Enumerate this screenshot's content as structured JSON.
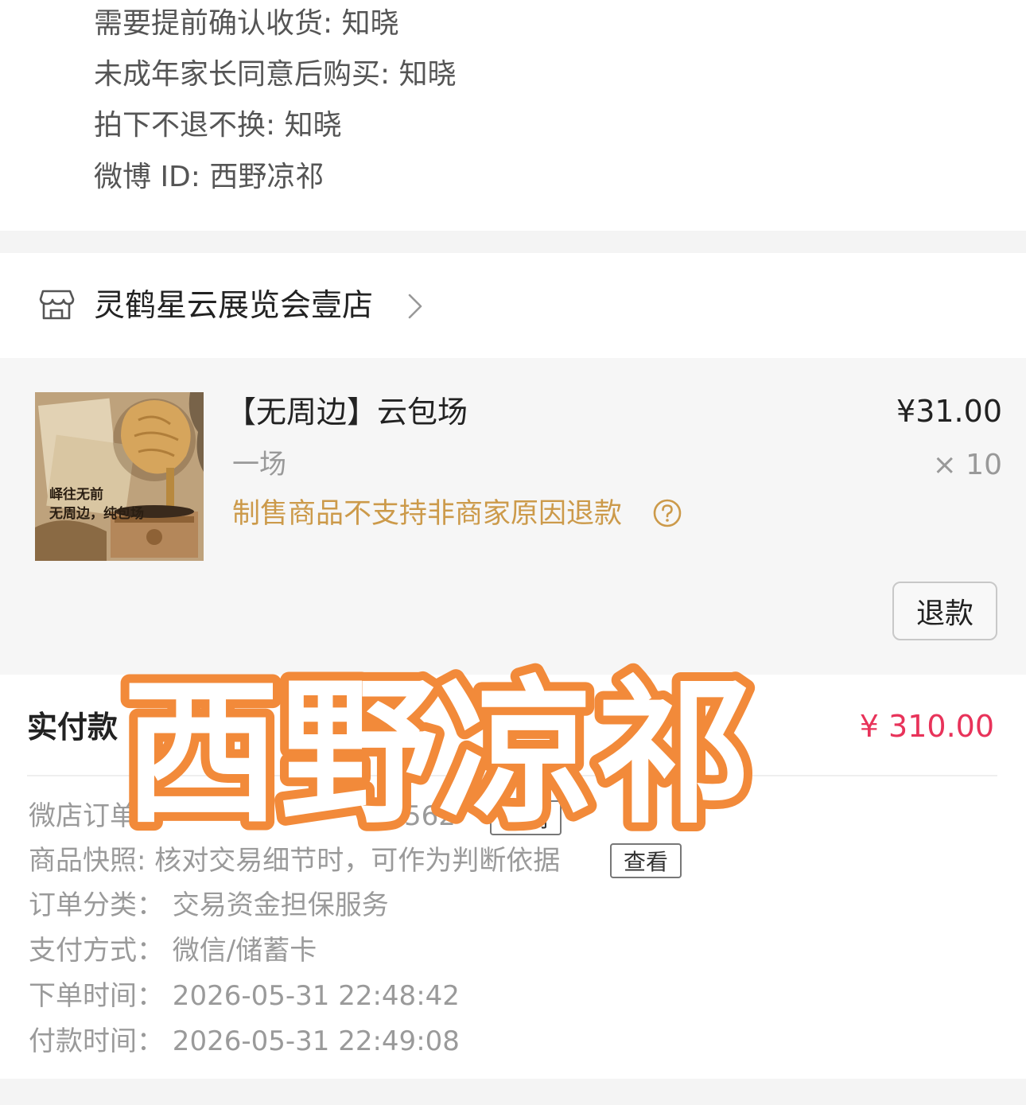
{
  "info_lines": [
    "需要提前确认收货: 知晓",
    "未成年家长同意后购买: 知晓",
    "拍下不退不换: 知晓",
    "微博 ID: 西野凉祁"
  ],
  "shop": {
    "name": "灵鹤星云展览会壹店",
    "icon": "shop-icon"
  },
  "product": {
    "title": "【无周边】云包场",
    "spec": "一场",
    "notice": "制售商品不支持非商家原因退款",
    "price": "¥31.00",
    "quantity": "× 10",
    "refund_label": "退款",
    "thumb_lines": [
      "峄往无前",
      "无周边，纯包场"
    ]
  },
  "payment": {
    "paid_label": "实付款",
    "paid_amount": "¥ 310.00",
    "order_no_label": "微店订单",
    "order_no_fragment": "562",
    "copy_label": "复制",
    "snapshot_line": "商品快照: 核对交易细节时，可作为判断依据",
    "view_label": "查看",
    "order_type": "订单分类：  交易资金担保服务",
    "pay_method": "支付方式：  微信/储蓄卡",
    "order_time": "下单时间：  2026-05-31 22:48:42",
    "pay_time": "付款时间：  2026-05-31 22:49:08"
  },
  "watermark": {
    "text": "西野凉祁",
    "color": "#f28a3a"
  },
  "colors": {
    "price_red": "#e8335a",
    "notice_gold": "#cc9a4a"
  }
}
